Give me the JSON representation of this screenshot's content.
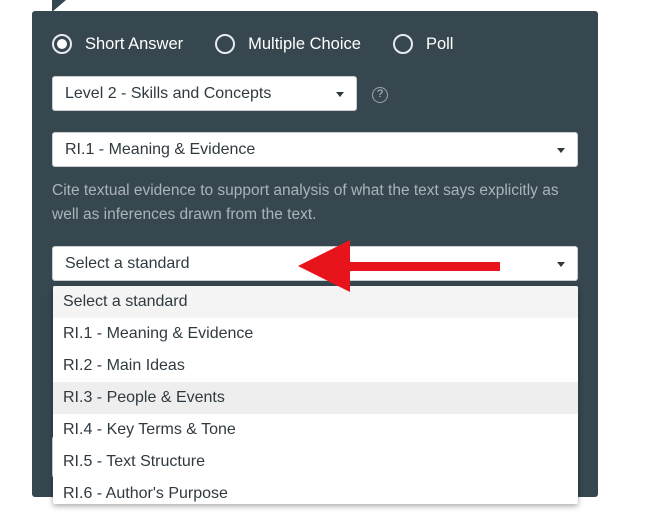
{
  "question_type": {
    "options": [
      {
        "label": "Short Answer",
        "selected": true
      },
      {
        "label": "Multiple Choice",
        "selected": false
      },
      {
        "label": "Poll",
        "selected": false
      }
    ]
  },
  "level_select": {
    "value": "Level 2 - Skills and Concepts"
  },
  "help_icon": {
    "glyph": "?"
  },
  "skill_select": {
    "value": "RI.1 - Meaning & Evidence"
  },
  "description": "Cite textual evidence to support analysis of what the text says explicitly as well as inferences drawn from the text.",
  "standard_select": {
    "value": "Select a standard",
    "options": [
      "Select a standard",
      "RI.1 - Meaning & Evidence",
      "RI.2 - Main Ideas",
      "RI.3 - People & Events",
      "RI.4 - Key Terms & Tone",
      "RI.5 - Text Structure",
      "RI.6 - Author's Purpose"
    ],
    "hovered_option": "RI.3 - People & Events"
  },
  "annotation": {
    "arrow_color": "#e8141c"
  },
  "colors": {
    "panel": "#37474f",
    "text_light": "#ffffff",
    "description": "#aab4b9"
  }
}
